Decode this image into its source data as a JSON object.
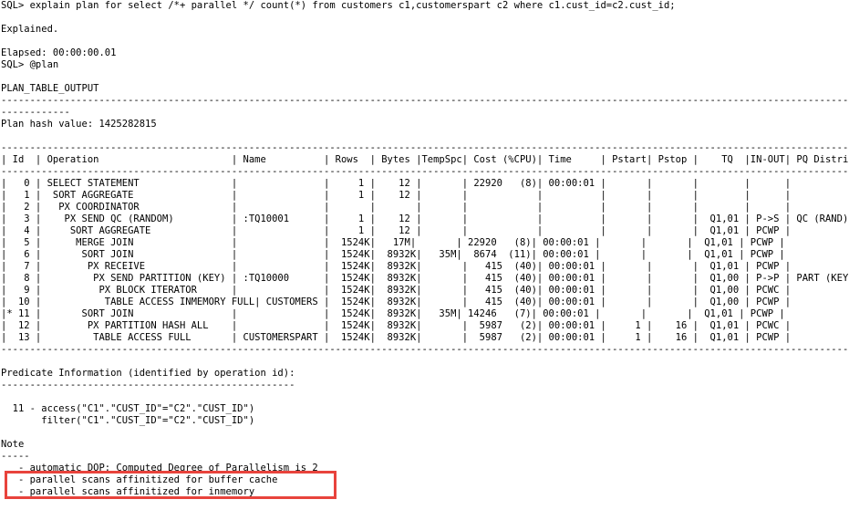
{
  "terminal": {
    "lines": [
      "SQL> explain plan for select /*+ parallel */ count(*) from customers c1,customerspart c2 where c1.cust_id=c2.cust_id;",
      "",
      "Explained.",
      "",
      "Elapsed: 00:00:00.01",
      "SQL> @plan",
      "",
      "PLAN_TABLE_OUTPUT",
      "------------------------------------------------------------------------------------------------------------------------------------------------------",
      "------------",
      "Plan hash value: 1425282815",
      "",
      "------------------------------------------------------------------------------------------------------------------------------------------------------",
      "| Id  | Operation                       | Name          | Rows  | Bytes |TempSpc| Cost (%CPU)| Time     | Pstart| Pstop |    TQ  |IN-OUT| PQ Distrib |",
      "------------------------------------------------------------------------------------------------------------------------------------------------------",
      "|   0 | SELECT STATEMENT                |               |     1 |    12 |       | 22920   (8)| 00:00:01 |       |       |        |      |            |",
      "|   1 |  SORT AGGREGATE                 |               |     1 |    12 |       |            |          |       |       |        |      |            |",
      "|   2 |   PX COORDINATOR                |               |       |       |       |            |          |       |       |        |      |            |",
      "|   3 |    PX SEND QC (RANDOM)          | :TQ10001      |     1 |    12 |       |            |          |       |       |  Q1,01 | P->S | QC (RAND)  |",
      "|   4 |     SORT AGGREGATE              |               |     1 |    12 |       |            |          |       |       |  Q1,01 | PCWP |            |",
      "|   5 |      MERGE JOIN                 |               |  1524K|   17M|       | 22920   (8)| 00:00:01 |       |       |  Q1,01 | PCWP |            |",
      "|   6 |       SORT JOIN                 |               |  1524K|  8932K|   35M|  8674  (11)| 00:00:01 |       |       |  Q1,01 | PCWP |            |",
      "|   7 |        PX RECEIVE               |               |  1524K|  8932K|       |   415  (40)| 00:00:01 |       |       |  Q1,01 | PCWP |            |",
      "|   8 |         PX SEND PARTITION (KEY) | :TQ10000      |  1524K|  8932K|       |   415  (40)| 00:00:01 |       |       |  Q1,00 | P->P | PART (KEY) |",
      "|   9 |          PX BLOCK ITERATOR      |               |  1524K|  8932K|       |   415  (40)| 00:00:01 |       |       |  Q1,00 | PCWC |            |",
      "|  10 |           TABLE ACCESS INMEMORY FULL| CUSTOMERS |  1524K|  8932K|       |   415  (40)| 00:00:01 |       |       |  Q1,00 | PCWP |            |",
      "|* 11 |       SORT JOIN                 |               |  1524K|  8932K|   35M| 14246   (7)| 00:00:01 |       |       |  Q1,01 | PCWP |            |",
      "|  12 |        PX PARTITION HASH ALL    |               |  1524K|  8932K|       |  5987   (2)| 00:00:01 |     1 |    16 |  Q1,01 | PCWC |            |",
      "|  13 |         TABLE ACCESS FULL       | CUSTOMERSPART |  1524K|  8932K|       |  5987   (2)| 00:00:01 |     1 |    16 |  Q1,01 | PCWP |            |",
      "------------------------------------------------------------------------------------------------------------------------------------------------------",
      "",
      "Predicate Information (identified by operation id):",
      "---------------------------------------------------",
      "",
      "",
      "  11 - access(\"C1\".\"CUST_ID\"=\"C2\".\"CUST_ID\")",
      "       filter(\"C1\".\"CUST_ID\"=\"C2\".\"CUST_ID\")",
      "",
      "Note",
      "-----",
      "   - automatic DOP: Computed Degree of Parallelism is 2",
      "   - parallel scans affinitized for buffer cache",
      "   - parallel scans affinitized for inmemory"
    ]
  },
  "highlight": {
    "color": "#e8433c"
  }
}
